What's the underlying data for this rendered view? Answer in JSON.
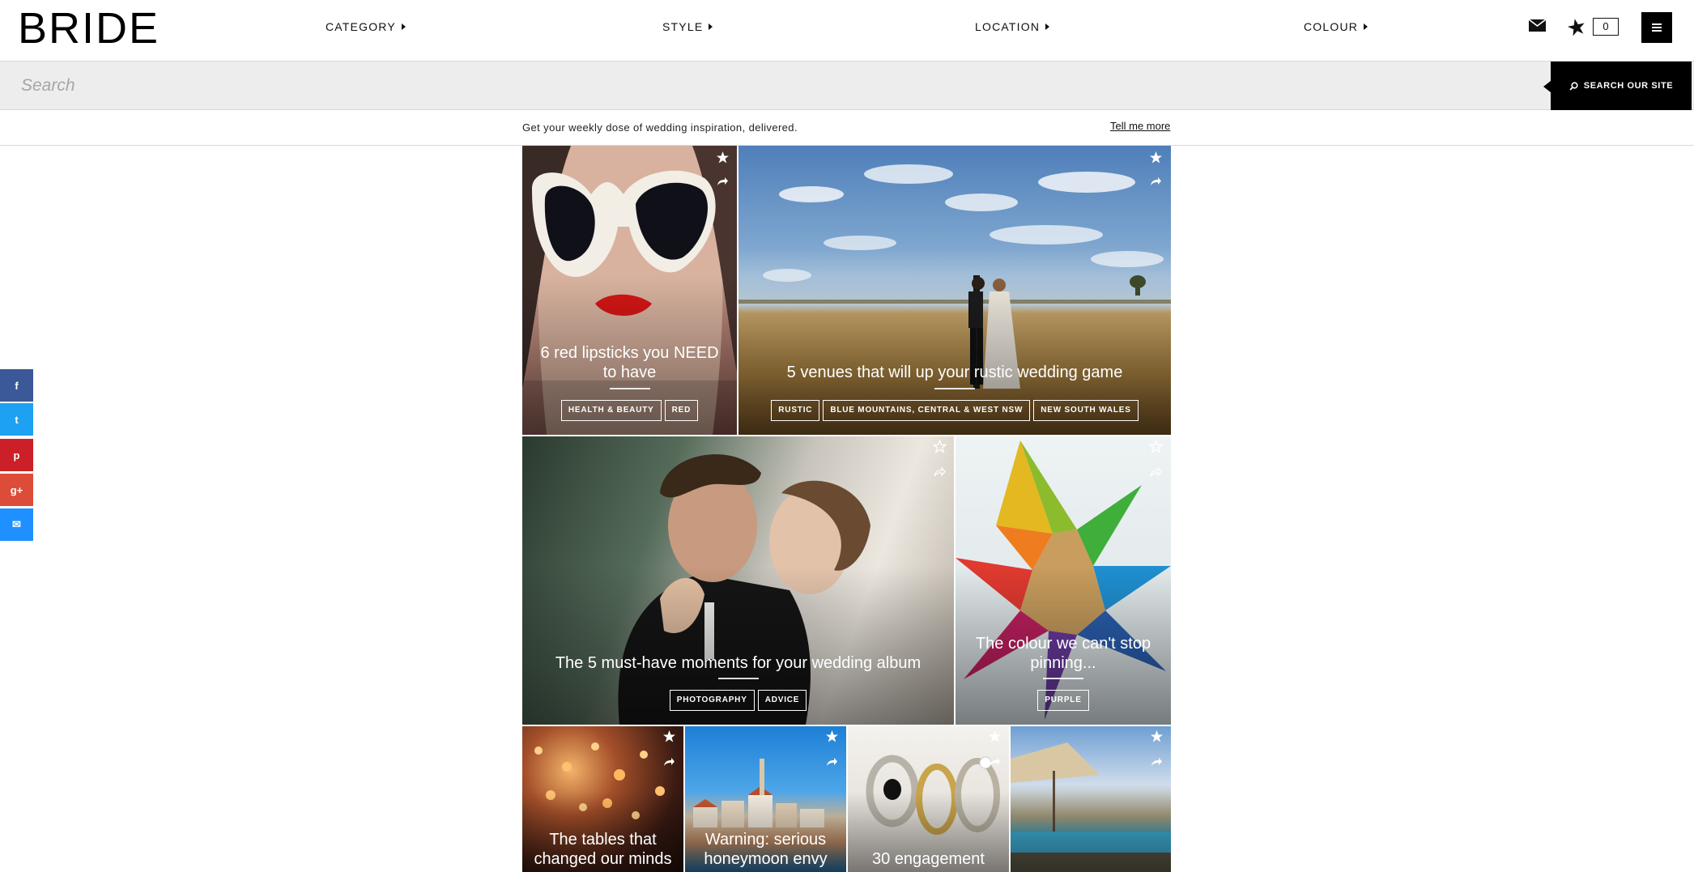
{
  "header": {
    "logo": "BRIDE",
    "nav": [
      "CATEGORY",
      "STYLE",
      "LOCATION",
      "COLOUR"
    ],
    "favourites_count": "0"
  },
  "search": {
    "placeholder": "Search",
    "button_label": "SEARCH OUR SITE"
  },
  "newsletter": {
    "text": "Get your weekly dose of wedding inspiration, delivered.",
    "link": "Tell me more"
  },
  "social": [
    {
      "icon": "facebook-icon",
      "glyph": "f",
      "color": "#3b5998"
    },
    {
      "icon": "twitter-icon",
      "glyph": "t",
      "color": "#1da1f2"
    },
    {
      "icon": "pinterest-icon",
      "glyph": "p",
      "color": "#cb2027"
    },
    {
      "icon": "google-plus-icon",
      "glyph": "g+",
      "color": "#dd4b39"
    },
    {
      "icon": "email-icon",
      "glyph": "✉",
      "color": "#1e90ff"
    }
  ],
  "tiles": [
    {
      "title": "6 red lipsticks you NEED to have",
      "tags": [
        "HEALTH & BEAUTY",
        "RED"
      ]
    },
    {
      "title": "5 venues that will up your rustic wedding game",
      "tags": [
        "RUSTIC",
        "BLUE MOUNTAINS, CENTRAL & WEST NSW",
        "NEW SOUTH WALES"
      ]
    },
    {
      "title": "The 5 must-have moments for your wedding album",
      "tags": [
        "PHOTOGRAPHY",
        "ADVICE"
      ]
    },
    {
      "title": "The colour we can't stop pinning...",
      "tags": [
        "PURPLE"
      ]
    },
    {
      "title": "The tables that changed our minds",
      "tags": []
    },
    {
      "title": "Warning: serious honeymoon envy",
      "tags": []
    },
    {
      "title": "30 engagement",
      "tags": []
    },
    {
      "title": "",
      "tags": []
    }
  ],
  "colors": {
    "brand": "#000000",
    "search_bg": "#ededed",
    "border": "#d8d8d8"
  }
}
